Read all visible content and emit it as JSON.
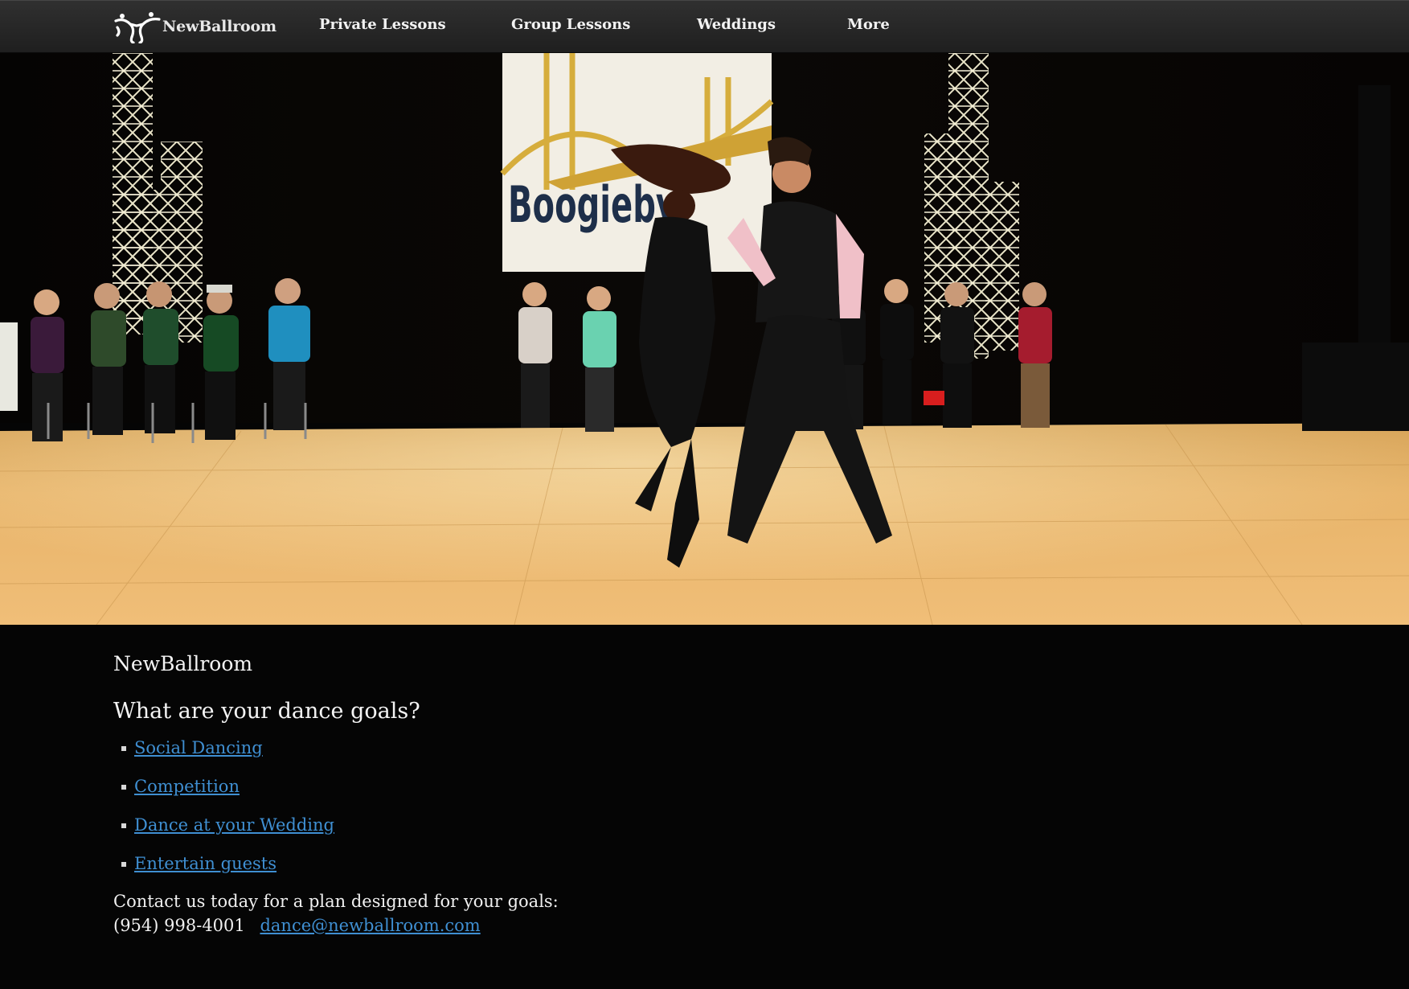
{
  "navbar": {
    "brand": "NewBallroom",
    "items": [
      {
        "label": "Private Lessons"
      },
      {
        "label": "Group Lessons"
      },
      {
        "label": "Weddings"
      },
      {
        "label": "More"
      }
    ]
  },
  "hero": {
    "banner_text": "Boogieby"
  },
  "main": {
    "site_name": "NewBallroom",
    "goals_heading": "What are your dance goals?",
    "goals": [
      {
        "label": "Social Dancing"
      },
      {
        "label": "Competition"
      },
      {
        "label": "Dance at your Wedding"
      },
      {
        "label": "Entertain guests"
      }
    ],
    "contact_line": "Contact us today for a plan designed for your goals:",
    "phone": "(954) 998-4001",
    "email": "dance@newballroom.com"
  },
  "colors": {
    "background": "#050505",
    "navbar": "#2a2a2a",
    "link": "#3f8fd2",
    "text": "#f0f0f0"
  }
}
